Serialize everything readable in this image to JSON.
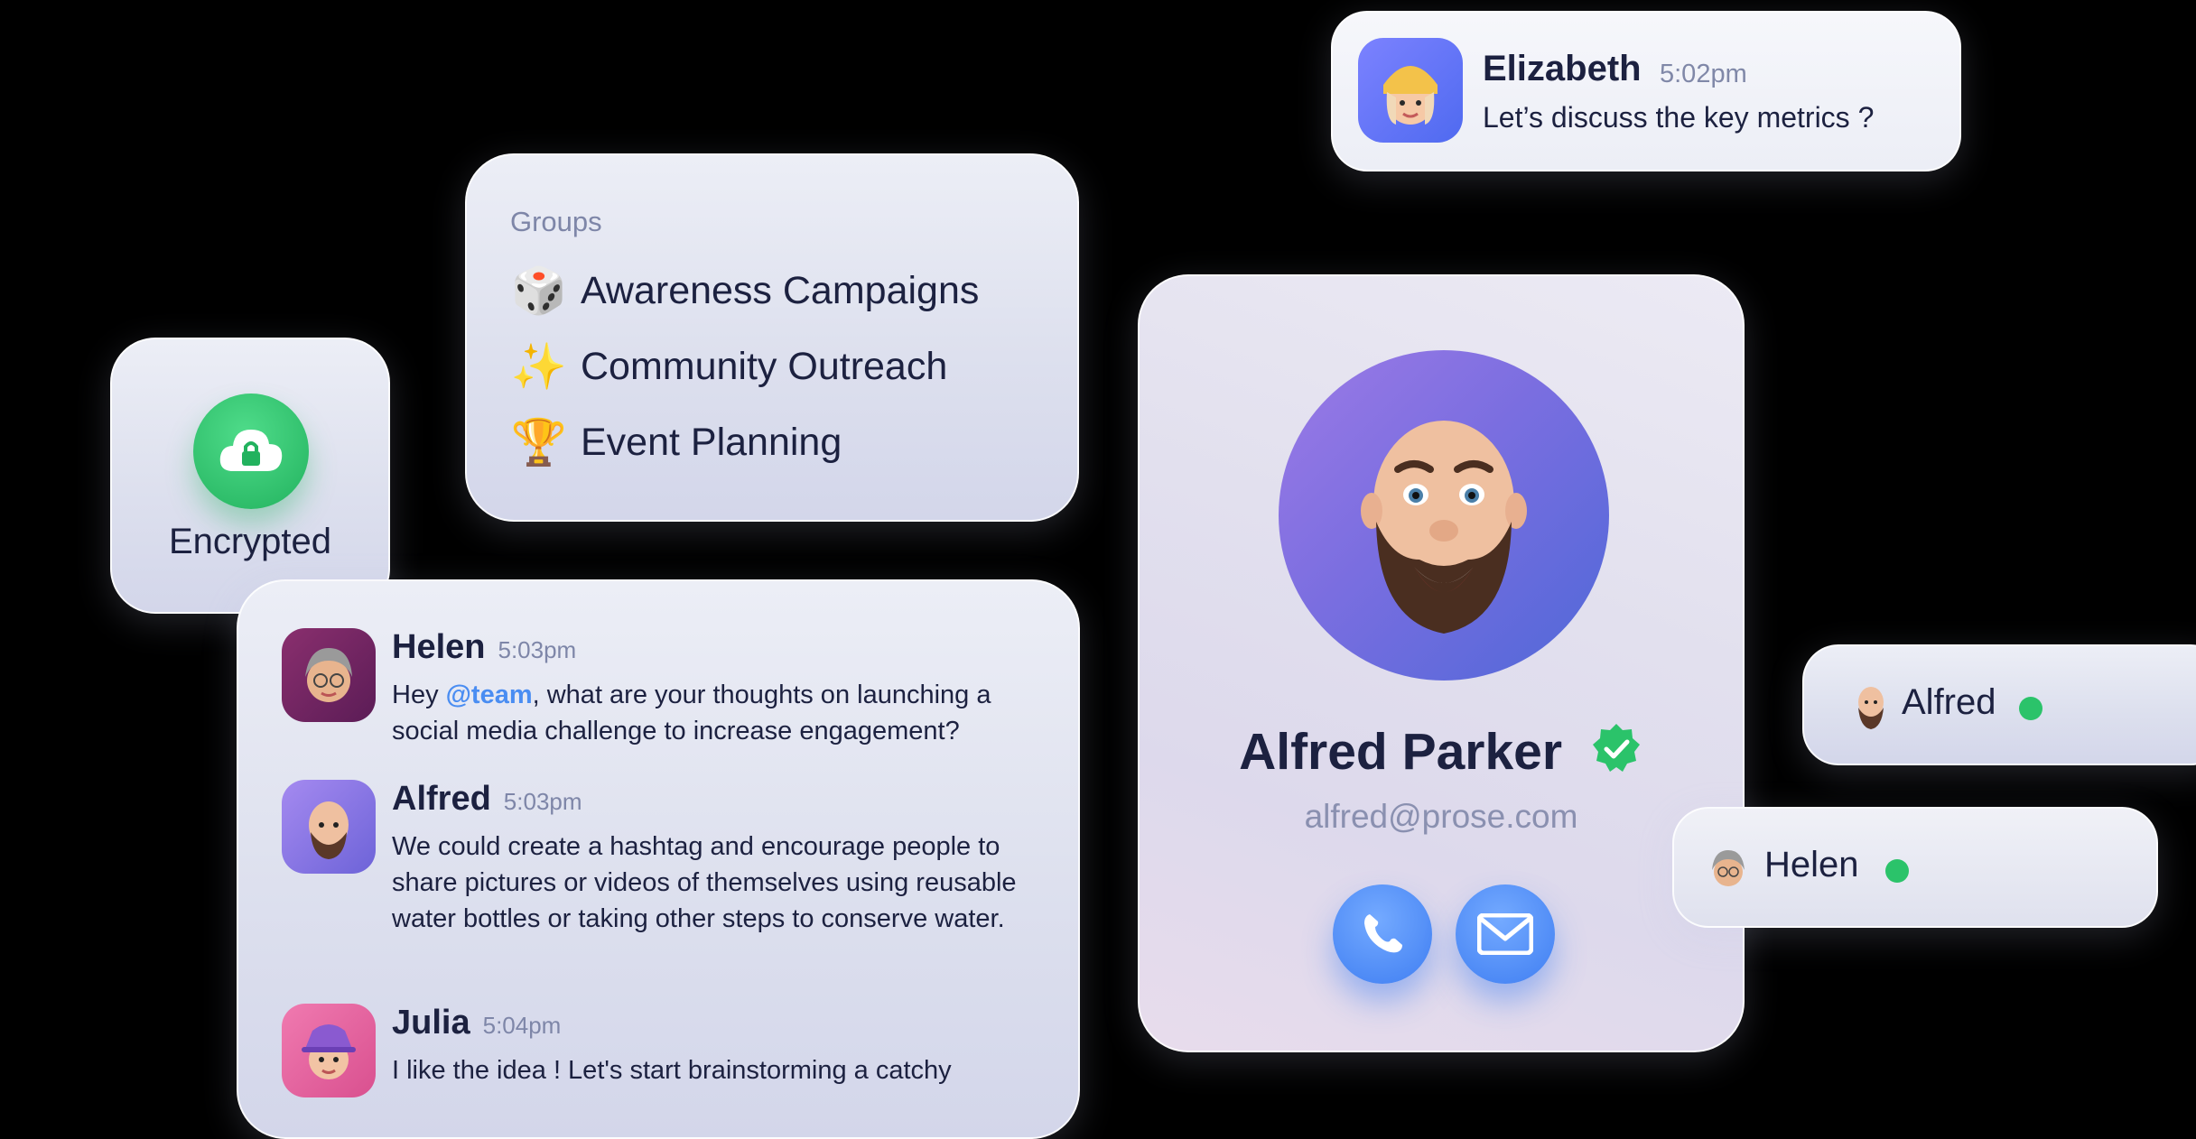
{
  "notification": {
    "name": "Elizabeth",
    "time": "5:02pm",
    "message": "Let’s discuss the key metrics ?",
    "avatar_icon": "memoji-woman-yellow-beanie"
  },
  "groups": {
    "title": "Groups",
    "items": [
      {
        "icon": "🎲",
        "icon_name": "dice-icon",
        "label": "Awareness Campaigns"
      },
      {
        "icon": "✨",
        "icon_name": "sparkles-icon",
        "label": "Community Outreach"
      },
      {
        "icon": "🏆",
        "icon_name": "trophy-icon",
        "label": "Event Planning"
      }
    ]
  },
  "encrypted": {
    "label": "Encrypted",
    "icon_name": "cloud-lock-icon",
    "color": "#2bc36a"
  },
  "chat": {
    "messages": [
      {
        "name": "Helen",
        "time": "5:03pm",
        "mention": "@team",
        "text_before": "Hey ",
        "text_after": ", what are your thoughts on launching a social media challenge to increase engagement?"
      },
      {
        "name": "Alfred",
        "time": "5:03pm",
        "text": "We could create a hashtag and encourage people to share pictures or videos of themselves using reusable water bottles or taking other steps to conserve water."
      },
      {
        "name": "Julia",
        "time": "5:04pm",
        "text": "I like the idea ! Let's start brainstorming a catchy"
      }
    ]
  },
  "profile": {
    "name": "Alfred Parker",
    "email": "alfred@prose.com",
    "verified_icon": "verified-badge-icon",
    "call_icon": "phone-icon",
    "mail_icon": "envelope-icon",
    "accent": "#3f7ef2"
  },
  "presence": [
    {
      "name": "Alfred",
      "status_color": "#2bc36a"
    },
    {
      "name": "Helen",
      "status_color": "#2bc36a"
    }
  ]
}
